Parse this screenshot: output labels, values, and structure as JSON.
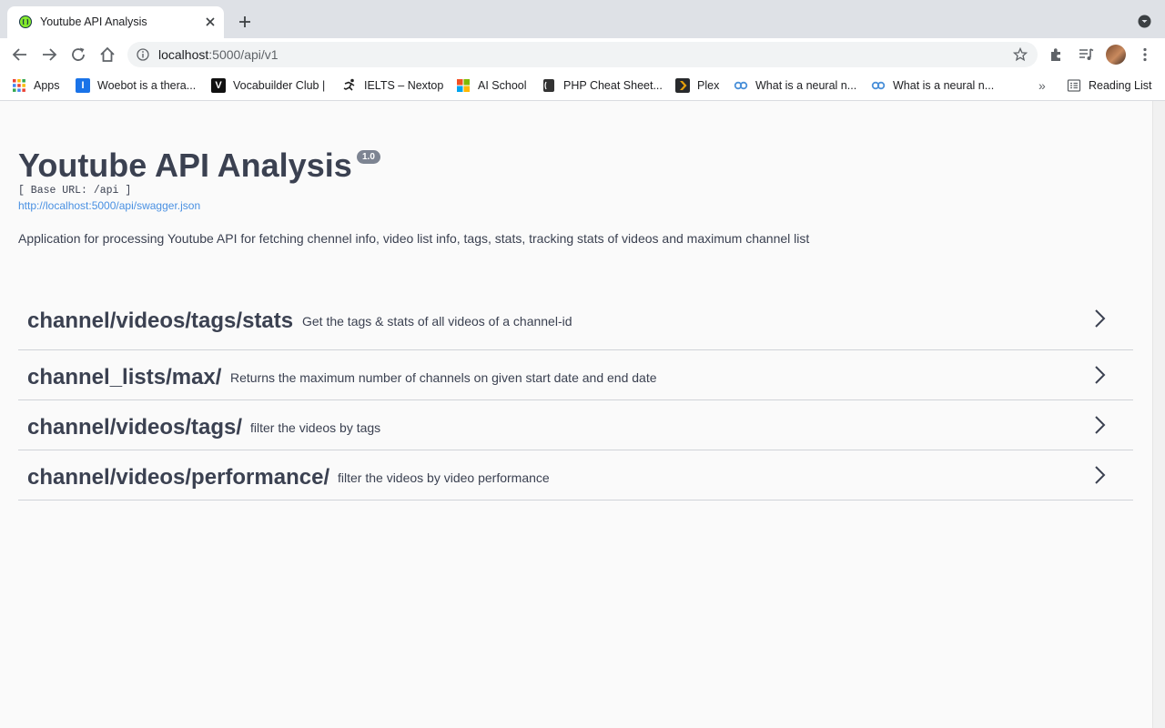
{
  "browser": {
    "tab_title": "Youtube API Analysis",
    "url_host": "localhost",
    "url_path": ":5000/api/v1",
    "bookmarks": [
      {
        "label": "Apps",
        "icon": "apps-grid-icon"
      },
      {
        "label": "Woebot is a thera...",
        "icon": "woebot-icon"
      },
      {
        "label": "Vocabuilder Club |",
        "icon": "vocabuilder-icon"
      },
      {
        "label": "IELTS – Nextop",
        "icon": "runner-icon"
      },
      {
        "label": "AI School",
        "icon": "microsoft-icon"
      },
      {
        "label": "PHP Cheat Sheet...",
        "icon": "php-icon"
      },
      {
        "label": "Plex",
        "icon": "plex-icon"
      },
      {
        "label": "What is a neural n...",
        "icon": "link-icon"
      },
      {
        "label": "What is a neural n...",
        "icon": "link-icon"
      }
    ],
    "reading_list": "Reading List",
    "overflow": "»"
  },
  "page": {
    "title": "Youtube API Analysis",
    "version": "1.0",
    "base_url": "[ Base URL: /api ]",
    "spec_url": "http://localhost:5000/api/swagger.json",
    "description": "Application for processing Youtube API for fetching chennel info, video list info, tags, stats, tracking stats of videos and maximum channel list",
    "operations": [
      {
        "path": "channel/videos/tags/stats",
        "summary": "Get the tags & stats of all videos of a channel-id"
      },
      {
        "path": "channel_lists/max/",
        "summary": "Returns the maximum number of channels on given start date and end date"
      },
      {
        "path": "channel/videos/tags/",
        "summary": "filter the videos by tags"
      },
      {
        "path": "channel/videos/performance/",
        "summary": "filter the videos by video performance"
      }
    ]
  },
  "colors": {
    "text": "#3b4151",
    "link": "#4990e2",
    "version_badge": "#7d8492",
    "page_bg": "#fafafa"
  }
}
